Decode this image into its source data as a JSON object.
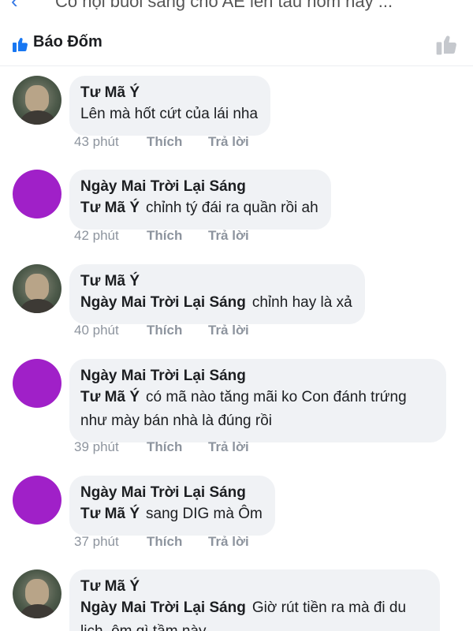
{
  "header": {
    "title": "Cổ hội buổi sáng cho AE lên tàu hôm nay ...",
    "back_icon": "chevron-left-icon"
  },
  "reactions": {
    "name": "Báo Đốm",
    "thumb_icon": "like-thumb-icon",
    "like_button_icon": "like-outline-icon",
    "accent": "#1877f2"
  },
  "actions": {
    "like": "Thích",
    "reply": "Trả lời"
  },
  "comments": [
    {
      "author": "Tư Mã Ý",
      "mention": "",
      "text": "Lên mà hốt cứt của lái nha",
      "time": "43 phút"
    },
    {
      "author": "Ngày Mai Trời Lại Sáng",
      "mention": "Tư Mã Ý",
      "text": "chỉnh tý đái ra quần rồi ah",
      "time": "42 phút"
    },
    {
      "author": "Tư Mã Ý",
      "mention": "Ngày Mai Trời Lại Sáng",
      "text": "chỉnh hay là xả",
      "time": "40 phút"
    },
    {
      "author": "Ngày Mai Trời Lại Sáng",
      "mention": "Tư Mã Ý",
      "text": "có mã nào tăng mãi ko Con đánh trứng như mày bán nhà là đúng rồi",
      "time": "39 phút"
    },
    {
      "author": "Ngày Mai Trời Lại Sáng",
      "mention": "Tư Mã Ý",
      "text": "sang DIG mà Ôm",
      "time": "37 phút"
    },
    {
      "author": "Tư Mã Ý",
      "mention": "Ngày Mai Trời Lại Sáng",
      "text": "Giờ rút tiền ra mà đi du lịch, ôm gì tầm này",
      "time": ""
    }
  ]
}
